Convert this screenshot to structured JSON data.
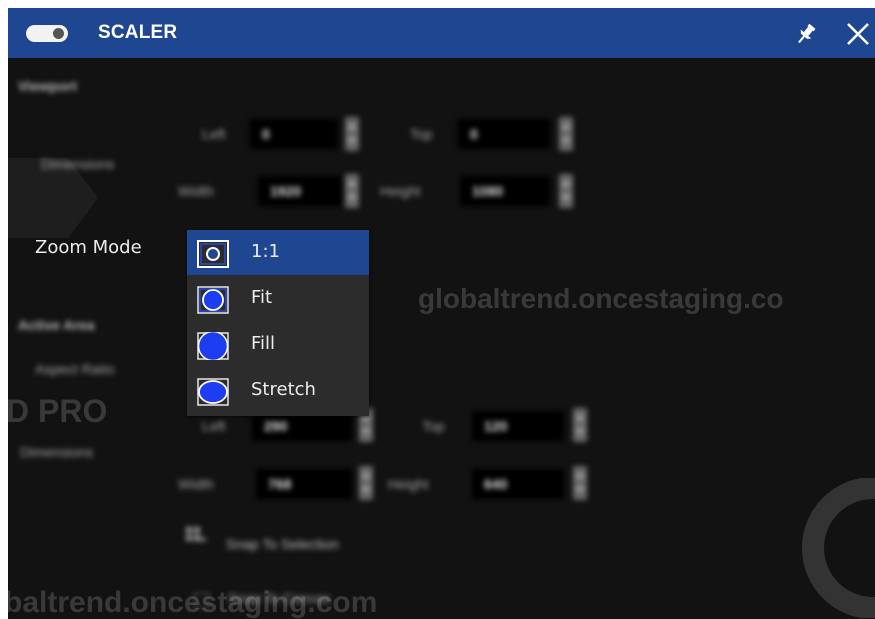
{
  "window": {
    "title": "SCALER",
    "accent_color": "#1f4690"
  },
  "titlebar_icons": {
    "toggle": "toggle-switch-icon",
    "pin": "pin-icon",
    "close": "close-icon"
  },
  "viewport": {
    "section_label": "Viewport",
    "dimensions_label": "Dimensions",
    "left_label": "Left",
    "left_value": "0",
    "top_label": "Top",
    "top_value": "0",
    "width_label": "Width",
    "width_value": "1920",
    "height_label": "Height",
    "height_value": "1080"
  },
  "zoom": {
    "label": "Zoom Mode",
    "selected": "1:1",
    "options": [
      {
        "label": "1:1",
        "icon": "zoom-1to1-icon"
      },
      {
        "label": "Fit",
        "icon": "zoom-fit-icon"
      },
      {
        "label": "Fill",
        "icon": "zoom-fill-icon"
      },
      {
        "label": "Stretch",
        "icon": "zoom-stretch-icon"
      }
    ]
  },
  "active_area": {
    "section_label": "Active Area",
    "aspect_ratio_label": "Aspect Ratio",
    "dimensions_label": "Dimensions",
    "left_label": "Left",
    "left_value": "290",
    "top_label": "Top",
    "top_value": "120",
    "width_label": "Width",
    "width_value": "768",
    "height_label": "Height",
    "height_value": "640",
    "snap_to_selection_label": "Snap To Selection",
    "snap_to_canvas_label": "Snap To Canvas"
  },
  "watermarks": {
    "mid_right": "globaltrend.oncestaging.co",
    "bottom_left": "baltrend.oncestaging.com",
    "left_brand": "D PRO"
  }
}
